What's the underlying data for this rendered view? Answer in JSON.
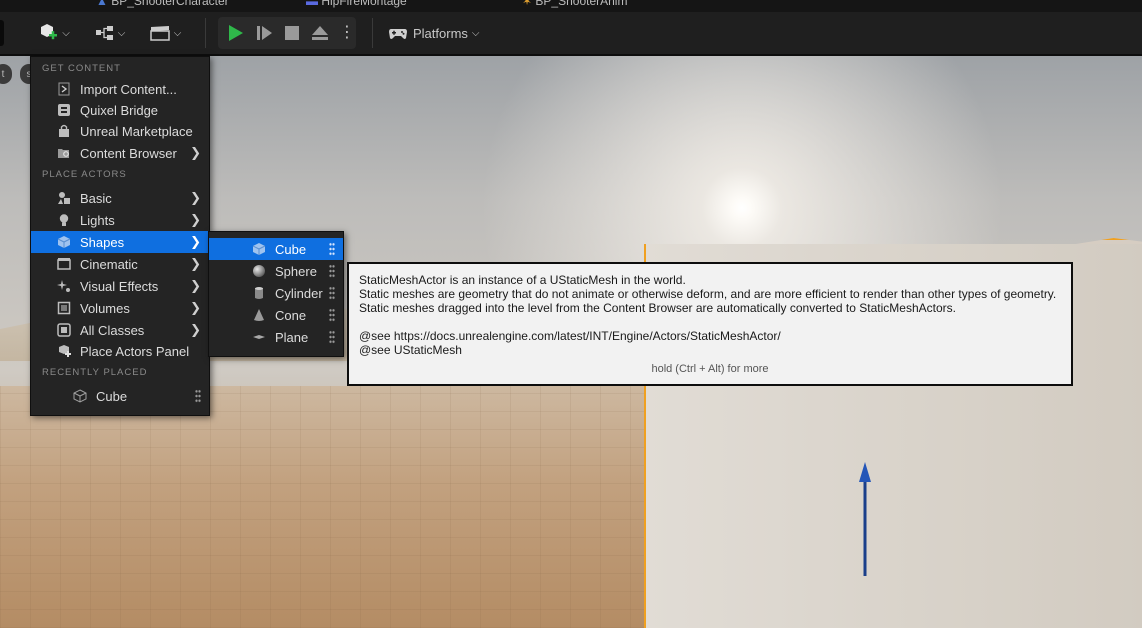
{
  "tabs": [
    {
      "label": "BP_ShooterCharacter"
    },
    {
      "label": "HipFireMontage"
    },
    {
      "label": "BP_ShooterAnim"
    }
  ],
  "toolbar": {
    "platforms_label": "Platforms"
  },
  "menu": {
    "sections": {
      "get_content": "GET CONTENT",
      "place_actors": "PLACE ACTORS",
      "recently_placed": "RECENTLY PLACED"
    },
    "get_content_items": [
      {
        "label": "Import Content..."
      },
      {
        "label": "Quixel Bridge"
      },
      {
        "label": "Unreal Marketplace"
      },
      {
        "label": "Content Browser"
      }
    ],
    "place_actors_items": [
      {
        "label": "Basic"
      },
      {
        "label": "Lights"
      },
      {
        "label": "Shapes"
      },
      {
        "label": "Cinematic"
      },
      {
        "label": "Visual Effects"
      },
      {
        "label": "Volumes"
      },
      {
        "label": "All Classes"
      },
      {
        "label": "Place Actors Panel"
      }
    ],
    "recent_items": [
      {
        "label": "Cube"
      }
    ]
  },
  "submenu": {
    "items": [
      {
        "label": "Cube"
      },
      {
        "label": "Sphere"
      },
      {
        "label": "Cylinder"
      },
      {
        "label": "Cone"
      },
      {
        "label": "Plane"
      }
    ]
  },
  "tooltip": {
    "line1": "StaticMeshActor is an instance of a UStaticMesh in the world.",
    "line2": "Static meshes are geometry that do not animate or otherwise deform, and are more efficient to render than other types of geometry.",
    "line3": "Static meshes dragged into the level from the Content Browser are automatically converted to StaticMeshActors.",
    "line4": "@see https://docs.unrealengine.com/latest/INT/Engine/Actors/StaticMeshActor/",
    "line5": "@see UStaticMesh",
    "hint": "hold (Ctrl + Alt) for more"
  },
  "colors": {
    "accent": "#0f6fe0",
    "selection_outline": "#f0a020",
    "play_green": "#2fb84a"
  }
}
